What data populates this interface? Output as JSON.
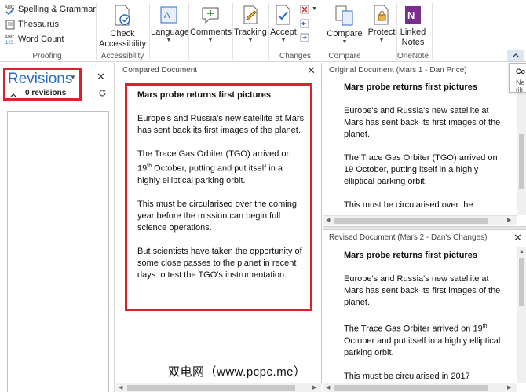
{
  "ribbon": {
    "proofing": {
      "spelling": "Spelling & Grammar",
      "thesaurus": "Thesaurus",
      "wordcount": "Word Count",
      "group": "Proofing"
    },
    "accessibility": {
      "check": "Check",
      "check2": "Accessibility",
      "group": "Accessibility"
    },
    "language": "Language",
    "comments": "Comments",
    "tracking": "Tracking",
    "changes": {
      "accept": "Accept",
      "group": "Changes"
    },
    "compare": {
      "compare": "Compare",
      "group": "Compare"
    },
    "protect": "Protect",
    "onenote": {
      "linked": "Linked",
      "notes": "Notes",
      "group": "OneNote"
    }
  },
  "revisions": {
    "title": "Revisions",
    "count": "0 revisions"
  },
  "compared": {
    "header": "Compared Document",
    "paragraphs": [
      "Mars probe returns first pictures",
      "Europe's and Russia's new satellite at Mars has sent back its first images of the planet.",
      "The Trace Gas Orbiter (TGO) arrived on 19th October, putting and put itself in a highly elliptical parking orbit.",
      "This must be circularised over the coming year before the mission can begin full science operations.",
      "But scientists have taken the opportunity of some close passes to the planet in recent days to test the TGO's instrumentation."
    ],
    "p3a": "The Trace Gas Orbiter (TGO) arrived on",
    "p3sup_num": "19",
    "p3sup": "th",
    "p3b": " October, putting and put itself in a highly elliptical parking orbit."
  },
  "original": {
    "header": "Original Document (Mars 1 - Dan Price)",
    "title": "Mars probe returns first pictures",
    "p1": "Europe's and Russia's new satellite at Mars has sent back its first images of the planet.",
    "p2": "The Trace Gas Orbiter (TGO) arrived on 19 October, putting itself in a highly elliptical parking orbit.",
    "p3": "This must be circularised over the"
  },
  "revised": {
    "header": "Revised Document (Mars 2 - Dan's Changes)",
    "title": "Mars probe returns first pictures",
    "p1": "Europe's and Russia's new satellite at Mars has sent back its first images of the planet.",
    "p2a": "The Trace Gas Orbiter arrived on 19",
    "p2sup": "th",
    "p2b": " October and put itself in a highly elliptical parking orbit.",
    "p3": "This must be circularised in 2017"
  },
  "tooltip": {
    "line1": "Co",
    "line2": "Ne",
    "line3": "rib"
  },
  "watermark": "双电网（www.pcpc.me）"
}
